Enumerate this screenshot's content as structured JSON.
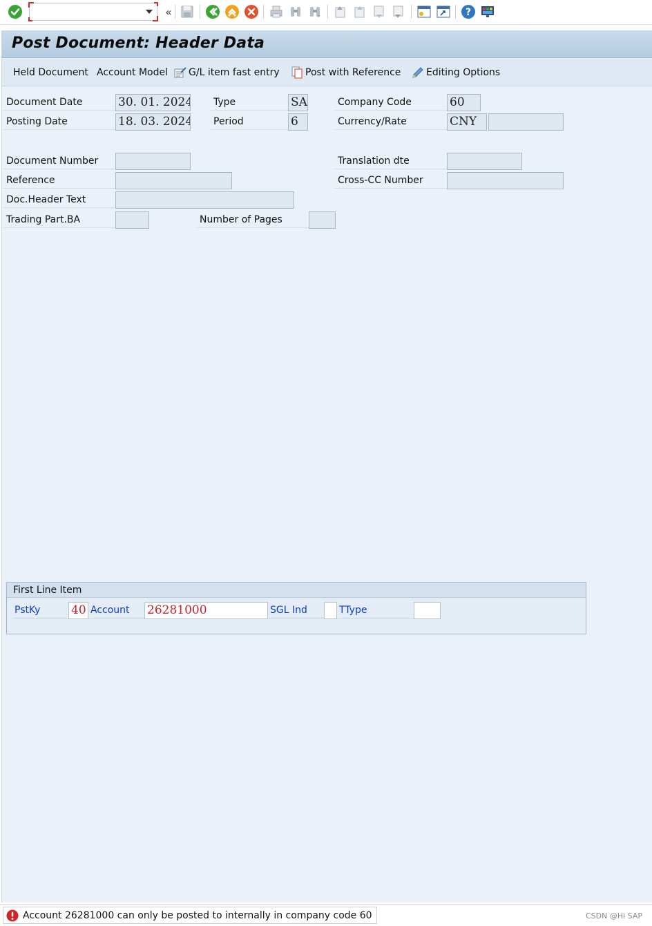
{
  "toolbar": {
    "command_placeholder": "",
    "icons": [
      "enter-icon",
      "history-icon",
      "save-icon",
      "back-icon",
      "exit-icon",
      "cancel-icon",
      "print-icon",
      "find-icon",
      "find-next-icon",
      "first-page-icon",
      "previous-page-icon",
      "next-page-icon",
      "last-page-icon",
      "create-session-icon",
      "shortcut-icon",
      "help-icon",
      "customize-layout-icon"
    ]
  },
  "title": "Post Document: Header Data",
  "app_toolbar": {
    "held_document": "Held Document",
    "account_model": "Account Model",
    "gl_fast_entry": "G/L item fast entry",
    "post_with_reference": "Post with Reference",
    "editing_options": "Editing Options"
  },
  "header": {
    "document_date": {
      "label": "Document Date",
      "value": "30. 01. 2024"
    },
    "posting_date": {
      "label": "Posting Date",
      "value": "18. 03. 2024"
    },
    "type": {
      "label": "Type",
      "value": "SA"
    },
    "period": {
      "label": "Period",
      "value": "6"
    },
    "company_code": {
      "label": "Company Code",
      "value": "60"
    },
    "currency_rate": {
      "label": "Currency/Rate",
      "value": "CNY",
      "rate": ""
    },
    "document_number": {
      "label": "Document Number",
      "value": ""
    },
    "translation_date": {
      "label": "Translation dte",
      "value": ""
    },
    "reference": {
      "label": "Reference",
      "value": ""
    },
    "cross_cc_number": {
      "label": "Cross-CC Number",
      "value": ""
    },
    "doc_header_text": {
      "label": "Doc.Header Text",
      "value": ""
    },
    "trading_part_ba": {
      "label": "Trading Part.BA",
      "value": ""
    },
    "number_of_pages": {
      "label": "Number of Pages",
      "value": ""
    }
  },
  "first_line_item": {
    "title": "First Line Item",
    "pstky": {
      "label": "PstKy",
      "value": "40"
    },
    "account": {
      "label": "Account",
      "value": "26281000"
    },
    "sgl_ind": {
      "label": "SGL Ind",
      "value": ""
    },
    "ttype": {
      "label": "TType",
      "value": ""
    }
  },
  "status": {
    "message": "Account 26281000 can only be posted to internally in company code 60",
    "watermark": "CSDN @Hi SAP"
  },
  "colors": {
    "error": "#d0262a",
    "link_blue": "#0a3cc7",
    "background": "#eaf1f8"
  }
}
